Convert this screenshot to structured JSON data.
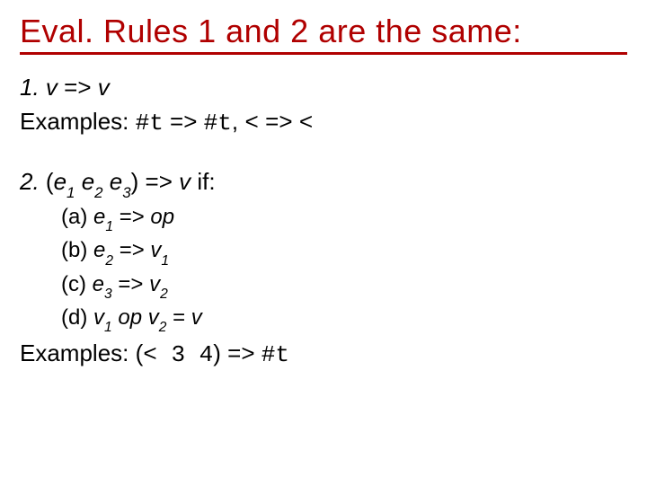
{
  "title": "Eval. Rules 1 and 2 are the same:",
  "rule1": {
    "num": "1.",
    "body_pre": "v",
    "arrow": " => ",
    "body_post": "v",
    "examples_label": "Examples:  ",
    "ex_t1": "#t",
    "ex_arrow1": " => ",
    "ex_t2": "#t",
    "comma": ", ",
    "ex_lt1": "<",
    "ex_arrow2": " => ",
    "ex_lt2": "<"
  },
  "rule2": {
    "num": "2.",
    "open": " (",
    "e": "e",
    "s1": "1",
    "sp": " ",
    "s2": "2",
    "s3": "3",
    "close": ") => ",
    "v": "v",
    "if": "  if:",
    "a_label": "(a) ",
    "a_e": "e",
    "a_sub": "1",
    "a_arrow": " => ",
    "a_op": "op",
    "b_label": "(b) ",
    "b_e": "e",
    "b_sub": "2",
    "b_arrow": " => ",
    "b_v": "v",
    "b_vsub": "1",
    "c_label": "(c) ",
    "c_e": "e",
    "c_sub": "3",
    "c_arrow": " => ",
    "c_v": "v",
    "c_vsub": "2",
    "d_label": "(d) ",
    "d_v1": "v",
    "d_v1sub": "1",
    "d_sp1": " ",
    "d_op": "op",
    "d_sp2": " ",
    "d_v2": "v",
    "d_v2sub": "2",
    "d_eq": " = ",
    "d_v": "v",
    "examples_label": "Examples:  (",
    "ex_lt": "<",
    "ex_args": " 3 4",
    "ex_close": ") => ",
    "ex_res": "#t"
  }
}
